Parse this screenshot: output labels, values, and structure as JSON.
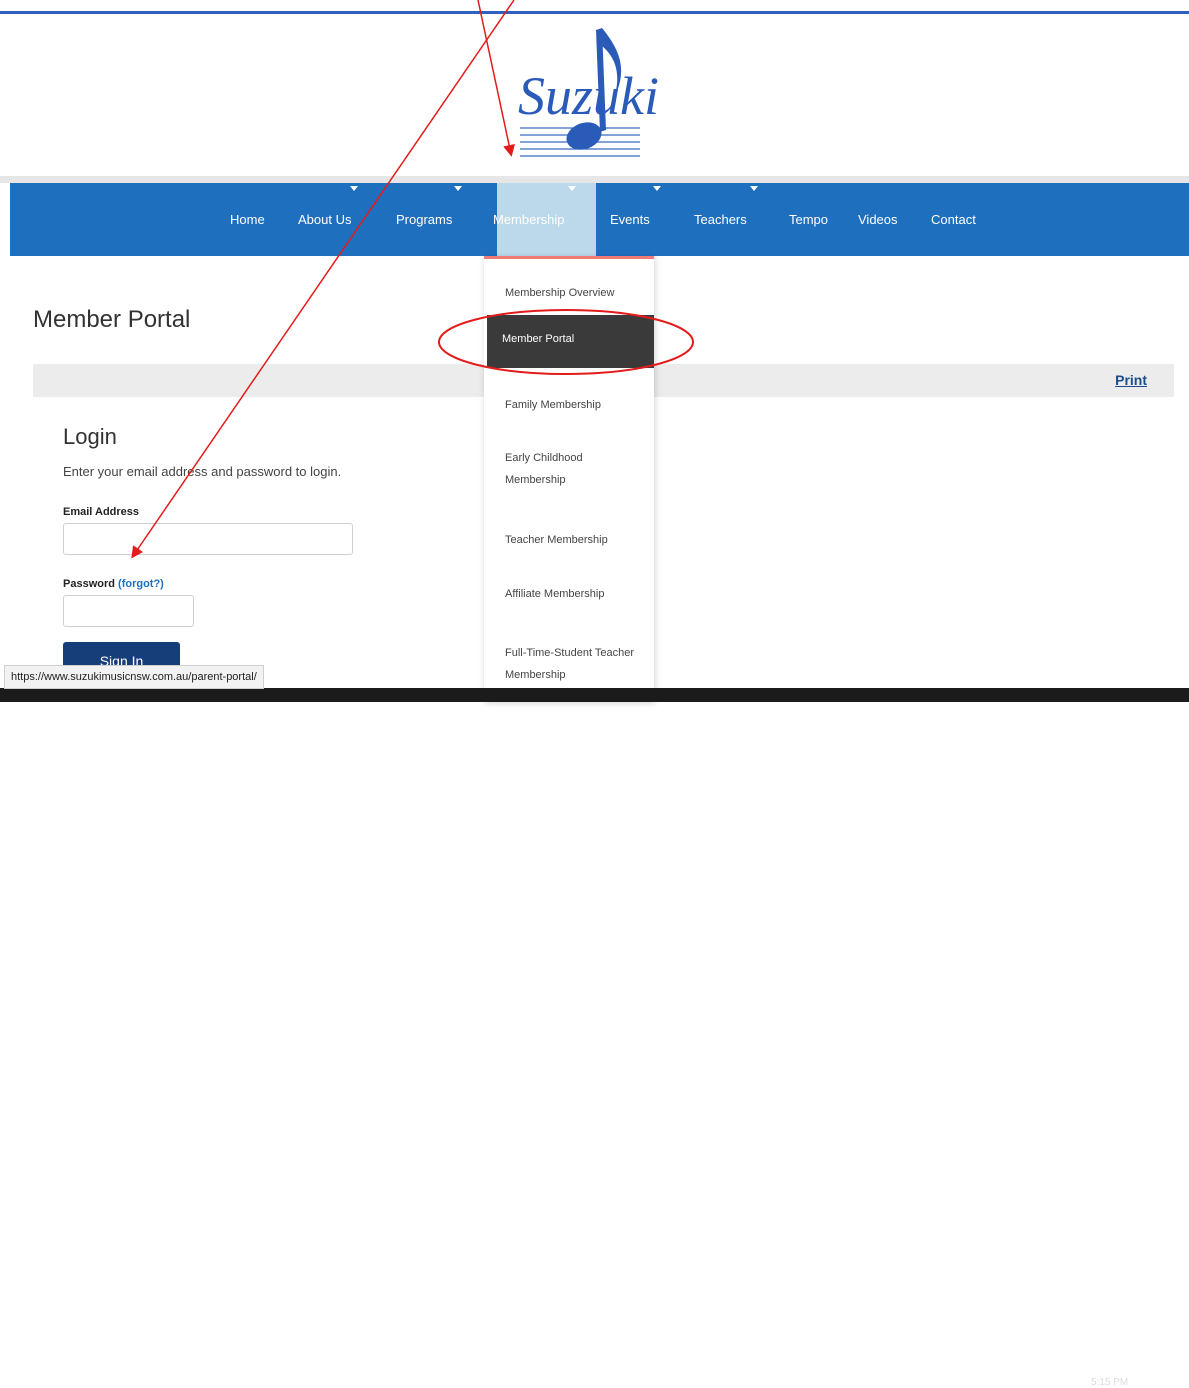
{
  "logo": {
    "text": "Suzuki"
  },
  "nav": {
    "items": [
      {
        "label": "Home"
      },
      {
        "label": "About Us"
      },
      {
        "label": "Programs"
      },
      {
        "label": "Membership"
      },
      {
        "label": "Events"
      },
      {
        "label": "Teachers"
      },
      {
        "label": "Tempo"
      },
      {
        "label": "Videos"
      },
      {
        "label": "Contact"
      }
    ],
    "active": "Membership"
  },
  "dropdown": {
    "items": [
      {
        "label": "Membership Overview"
      },
      {
        "label": "Member Portal"
      },
      {
        "label": "Family Membership"
      },
      {
        "label": "Early Childhood",
        "label2": "Membership"
      },
      {
        "label": "Teacher Membership"
      },
      {
        "label": "Affiliate Membership"
      },
      {
        "label": "Full-Time-Student Teacher",
        "label2": "Membership"
      }
    ],
    "active": "Member Portal"
  },
  "page": {
    "title": "Member Portal",
    "print_label": "Print"
  },
  "login": {
    "heading": "Login",
    "description": "Enter your email address and password to login.",
    "email_label": "Email Address",
    "email_value": "",
    "password_label": "Password",
    "forgot_label": "(forgot?)",
    "password_value": "",
    "signin_label": "Sign In"
  },
  "status_bar": {
    "url": "https://www.suzukimusicnsw.com.au/parent-portal/"
  },
  "taskbar": {
    "clock": "5:15 PM"
  },
  "colors": {
    "nav_bg": "#1f6fbf",
    "nav_active_bg": "#bcd9ec",
    "dropdown_active_bg": "#3a3a3a",
    "signin_bg": "#163f7a",
    "annotation_red": "#e41b1b"
  }
}
